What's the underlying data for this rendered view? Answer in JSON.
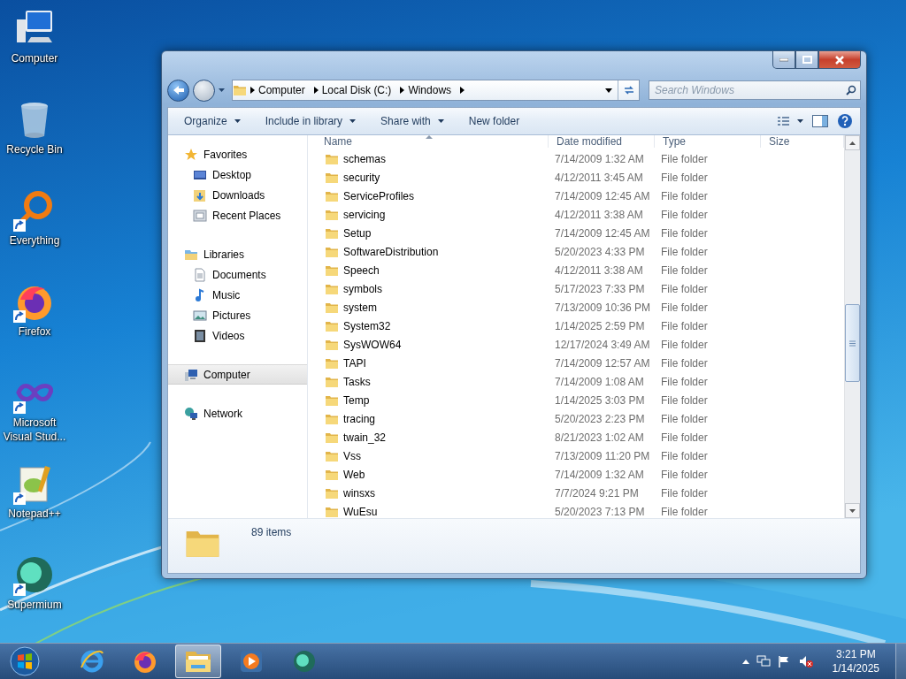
{
  "desktop_icons": [
    {
      "label": "Computer",
      "kind": "computer",
      "shortcut": false
    },
    {
      "label": "Recycle Bin",
      "kind": "recycle",
      "shortcut": false
    },
    {
      "label": "Everything",
      "kind": "everything",
      "shortcut": true
    },
    {
      "label": "Firefox",
      "kind": "firefox",
      "shortcut": true
    },
    {
      "label": "Microsoft Visual Stud...",
      "kind": "vs",
      "shortcut": true
    },
    {
      "label": "Notepad++",
      "kind": "notepad",
      "shortcut": true
    },
    {
      "label": "Supermium",
      "kind": "supermium",
      "shortcut": true
    }
  ],
  "window": {
    "address": [
      "Computer",
      "Local Disk (C:)",
      "Windows"
    ],
    "search": {
      "placeholder": "Search Windows"
    },
    "toolbar": [
      {
        "label": "Organize",
        "menu": true
      },
      {
        "label": "Include in library",
        "menu": true
      },
      {
        "label": "Share with",
        "menu": true
      },
      {
        "label": "New folder",
        "menu": false
      }
    ],
    "nav_pane": [
      {
        "label": "Favorites",
        "kind": "star",
        "selected": false,
        "children": [
          {
            "label": "Desktop",
            "kind": "desktop",
            "selected": false
          },
          {
            "label": "Downloads",
            "kind": "downloads",
            "selected": false
          },
          {
            "label": "Recent Places",
            "kind": "recent",
            "selected": false
          }
        ]
      },
      {
        "label": "Libraries",
        "kind": "libraries",
        "selected": false,
        "children": [
          {
            "label": "Documents",
            "kind": "documents",
            "selected": false
          },
          {
            "label": "Music",
            "kind": "music",
            "selected": false
          },
          {
            "label": "Pictures",
            "kind": "pictures",
            "selected": false
          },
          {
            "label": "Videos",
            "kind": "videos",
            "selected": false
          }
        ]
      },
      {
        "label": "Computer",
        "kind": "computer",
        "selected": true
      },
      {
        "label": "Network",
        "kind": "network",
        "selected": false
      }
    ],
    "columns": [
      {
        "label": "Name",
        "sorted": true
      },
      {
        "label": "Date modified",
        "sorted": false
      },
      {
        "label": "Type",
        "sorted": false
      },
      {
        "label": "Size",
        "sorted": false
      }
    ],
    "rows": [
      {
        "name": "schemas",
        "date": "7/14/2009 1:32 AM",
        "type": "File folder"
      },
      {
        "name": "security",
        "date": "4/12/2011 3:45 AM",
        "type": "File folder"
      },
      {
        "name": "ServiceProfiles",
        "date": "7/14/2009 12:45 AM",
        "type": "File folder"
      },
      {
        "name": "servicing",
        "date": "4/12/2011 3:38 AM",
        "type": "File folder"
      },
      {
        "name": "Setup",
        "date": "7/14/2009 12:45 AM",
        "type": "File folder"
      },
      {
        "name": "SoftwareDistribution",
        "date": "5/20/2023 4:33 PM",
        "type": "File folder"
      },
      {
        "name": "Speech",
        "date": "4/12/2011 3:38 AM",
        "type": "File folder"
      },
      {
        "name": "symbols",
        "date": "5/17/2023 7:33 PM",
        "type": "File folder"
      },
      {
        "name": "system",
        "date": "7/13/2009 10:36 PM",
        "type": "File folder"
      },
      {
        "name": "System32",
        "date": "1/14/2025 2:59 PM",
        "type": "File folder"
      },
      {
        "name": "SysWOW64",
        "date": "12/17/2024 3:49 AM",
        "type": "File folder"
      },
      {
        "name": "TAPI",
        "date": "7/14/2009 12:57 AM",
        "type": "File folder"
      },
      {
        "name": "Tasks",
        "date": "7/14/2009 1:08 AM",
        "type": "File folder"
      },
      {
        "name": "Temp",
        "date": "1/14/2025 3:03 PM",
        "type": "File folder"
      },
      {
        "name": "tracing",
        "date": "5/20/2023 2:23 PM",
        "type": "File folder"
      },
      {
        "name": "twain_32",
        "date": "8/21/2023 1:02 AM",
        "type": "File folder"
      },
      {
        "name": "Vss",
        "date": "7/13/2009 11:20 PM",
        "type": "File folder"
      },
      {
        "name": "Web",
        "date": "7/14/2009 1:32 AM",
        "type": "File folder"
      },
      {
        "name": "winsxs",
        "date": "7/7/2024 9:21 PM",
        "type": "File folder"
      },
      {
        "name": "WuEsu",
        "date": "5/20/2023 7:13 PM",
        "type": "File folder"
      }
    ],
    "details": {
      "count": "89 items"
    }
  },
  "taskbar": {
    "items": [
      {
        "kind": "ie",
        "active": false
      },
      {
        "kind": "firefox",
        "active": false
      },
      {
        "kind": "explorer",
        "active": true
      },
      {
        "kind": "media",
        "active": false
      },
      {
        "kind": "supermium",
        "active": false
      }
    ],
    "clock": {
      "time": "3:21 PM",
      "date": "1/14/2025"
    }
  }
}
